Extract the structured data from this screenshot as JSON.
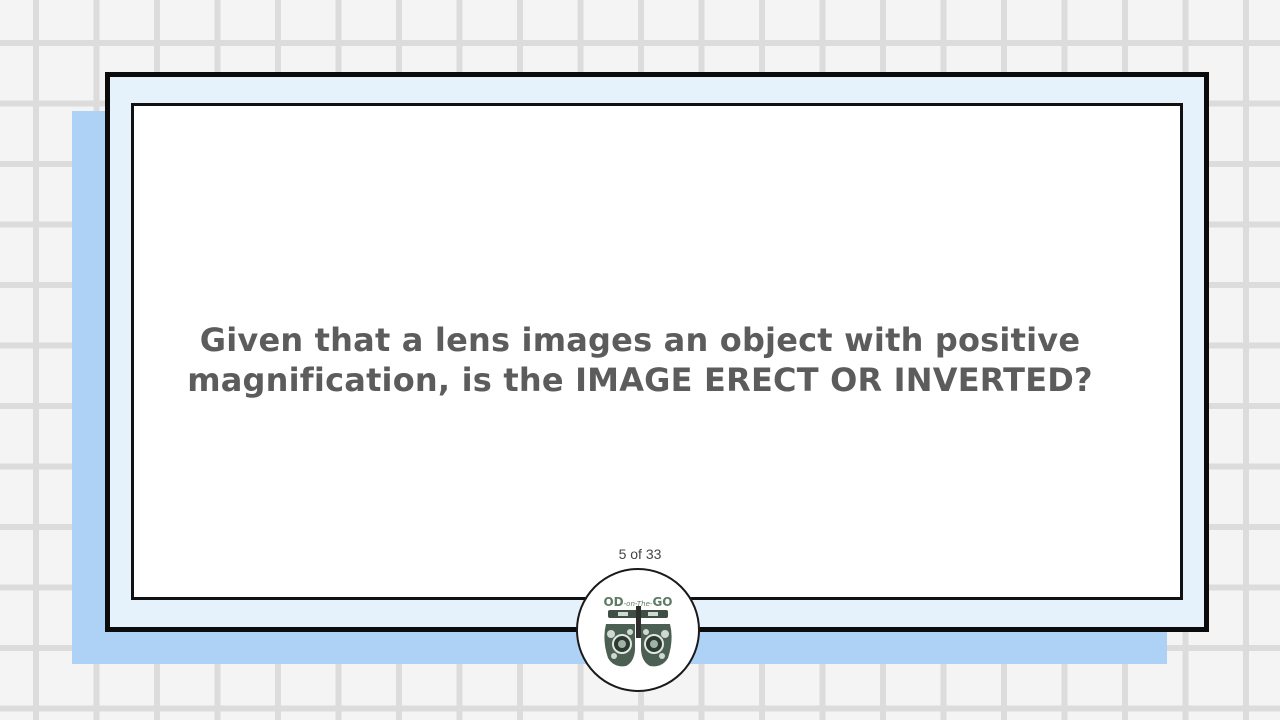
{
  "slide": {
    "question_line_1": "Given that a lens images an object with positive",
    "question_line_2": "magnification, is the IMAGE ERECT OR INVERTED?",
    "counter": "5 of 33"
  },
  "logo": {
    "text": "OD-on-The-GO",
    "icon": "phoropter-icon"
  },
  "colors": {
    "background": "#f4f4f4",
    "grid": "#dcdcdc",
    "shadow": "#aed2f5",
    "card_fill": "#e6f2fb",
    "border": "#0b0b0b",
    "text": "#5c5c5c",
    "logo_green": "#5d7a63"
  }
}
